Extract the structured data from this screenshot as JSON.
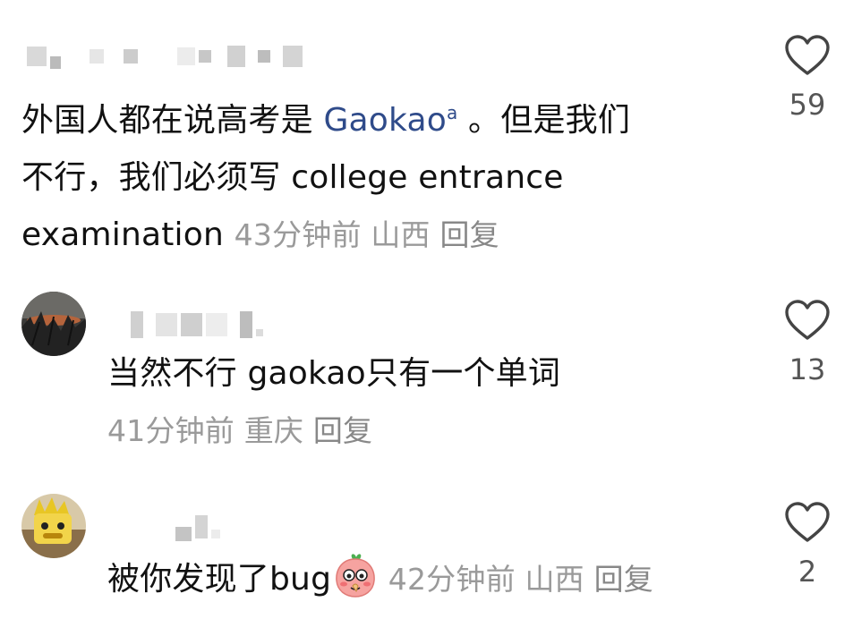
{
  "comments": [
    {
      "line1_prefix": "外国人都在说高考是 ",
      "link": "Gaokao",
      "line1_suffix": " 。但是我们",
      "line2": "不行，我们必须写 college entrance",
      "line3": "examination",
      "time": "43分钟前",
      "location": "山西",
      "reply": "回复",
      "likes": "59"
    },
    {
      "text": "当然不行 gaokao只有一个单词",
      "time": "41分钟前",
      "location": "重庆",
      "reply": "回复",
      "likes": "13"
    },
    {
      "text": "被你发现了bug",
      "emoji": "peach-blush-emoji",
      "time": "42分钟前",
      "location": "山西",
      "reply": "回复",
      "likes": "2"
    }
  ],
  "icons": {
    "like": "heart-outline-icon",
    "link": "search-icon"
  },
  "colors": {
    "link": "#2f4b8a",
    "meta": "#9a9a9a",
    "text": "#111111"
  }
}
